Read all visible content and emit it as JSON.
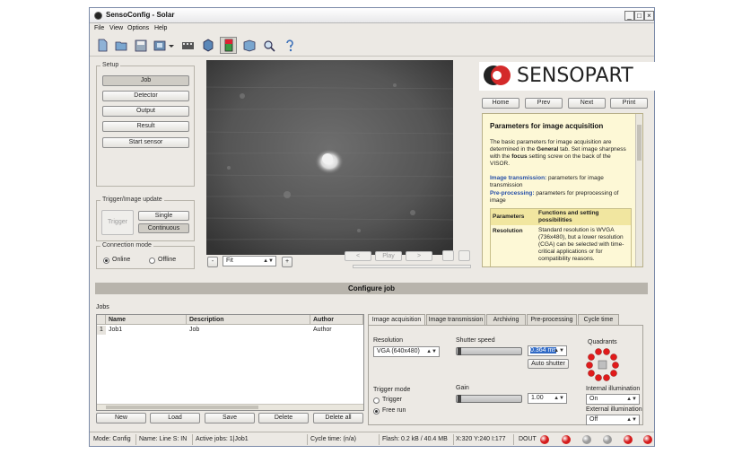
{
  "window": {
    "title": "SensoConfig - Solar",
    "buttons": [
      "_",
      "□",
      "×"
    ]
  },
  "menu": [
    "File",
    "View",
    "Options",
    "Help"
  ],
  "toolbar_icons": [
    "new-icon",
    "open-icon",
    "save-icon",
    "connect-icon",
    "record-icon",
    "sensor-icon",
    "image-icon",
    "view-icon",
    "search-icon",
    "help-icon"
  ],
  "setup": {
    "title": "Setup",
    "buttons": {
      "job": "Job",
      "detector": "Detector",
      "output": "Output",
      "result": "Result",
      "start": "Start sensor"
    }
  },
  "trigger_update": {
    "title": "Trigger/Image update",
    "trigger": "Trigger",
    "single": "Single",
    "continuous": "Continuous"
  },
  "connection": {
    "title": "Connection mode",
    "online": "Online",
    "offline": "Offline"
  },
  "zoom": {
    "minus": "-",
    "plus": "+",
    "value": "Fit"
  },
  "playback": {
    "prev": "<",
    "play": "Play",
    "next": ">"
  },
  "logo": {
    "brand": "SENSOPART",
    "colors": {
      "red": "#d42a2a",
      "dark": "#222222"
    }
  },
  "help_nav": {
    "home": "Home",
    "prev": "Prev",
    "next": "Next",
    "print": "Print"
  },
  "help": {
    "title": "Parameters for image acquisition",
    "intro_1": "The basic parameters for image acquisition are determined in the",
    "intro_general": "General",
    "intro_2": "tab. Set image sharpness with the",
    "intro_focus": "focus",
    "intro_3": "setting screw on the back of the VISOR.",
    "link1": "Image transmission:",
    "link1_text": "parameters for image transmission",
    "link2": "Pre-processing:",
    "link2_text": "parameters for preprocessing of image",
    "table_head": [
      "Parameters",
      "Functions and setting possibilities"
    ],
    "row_param": "Resolution",
    "row_text": "Standard resolution is WVGA (736x480), but a lower resolution (CGA) can be selected with time-critical applications or for compatibility reasons."
  },
  "configure_job": "Configure job",
  "jobs": {
    "title": "Jobs",
    "columns": [
      "Name",
      "Description",
      "Author"
    ],
    "rows": [
      {
        "index": "1",
        "name": "Job1",
        "description": "Job",
        "author": "Author"
      }
    ],
    "buttons": {
      "new": "New",
      "load": "Load",
      "save": "Save",
      "delete": "Delete",
      "delete_all": "Delete all"
    }
  },
  "tabs": [
    "Image acquisition",
    "Image transmission",
    "Archiving",
    "Pre-processing",
    "Cycle time"
  ],
  "acquisition": {
    "resolution_label": "Resolution",
    "resolution_value": "VGA (640x480)",
    "shutter_label": "Shutter speed",
    "shutter_value": "0.364 ms",
    "auto_shutter": "Auto shutter",
    "trigger_mode_label": "Trigger mode",
    "trigger": "Trigger",
    "free_run": "Free run",
    "gain_label": "Gain",
    "gain_value": "1.00",
    "quadrants_label": "Quadrants",
    "internal_label": "Internal illumination",
    "internal_value": "On",
    "external_label": "External illumination",
    "external_value": "Off"
  },
  "statusbar": {
    "mode": "Mode:   Config",
    "name": "Name:   Line S: IN",
    "active_jobs": "Active jobs:   1|Job1",
    "cycle": "Cycle time:   (n/a)",
    "flash": "Flash:   0.2 kB / 40.4 MB",
    "coords": "X:320 Y:240 I:177",
    "dout": "DOUT",
    "led_colors": [
      "#d41c1c",
      "#d41c1c",
      "#9a9a9a",
      "#9a9a9a",
      "#d41c1c",
      "#d41c1c"
    ]
  }
}
